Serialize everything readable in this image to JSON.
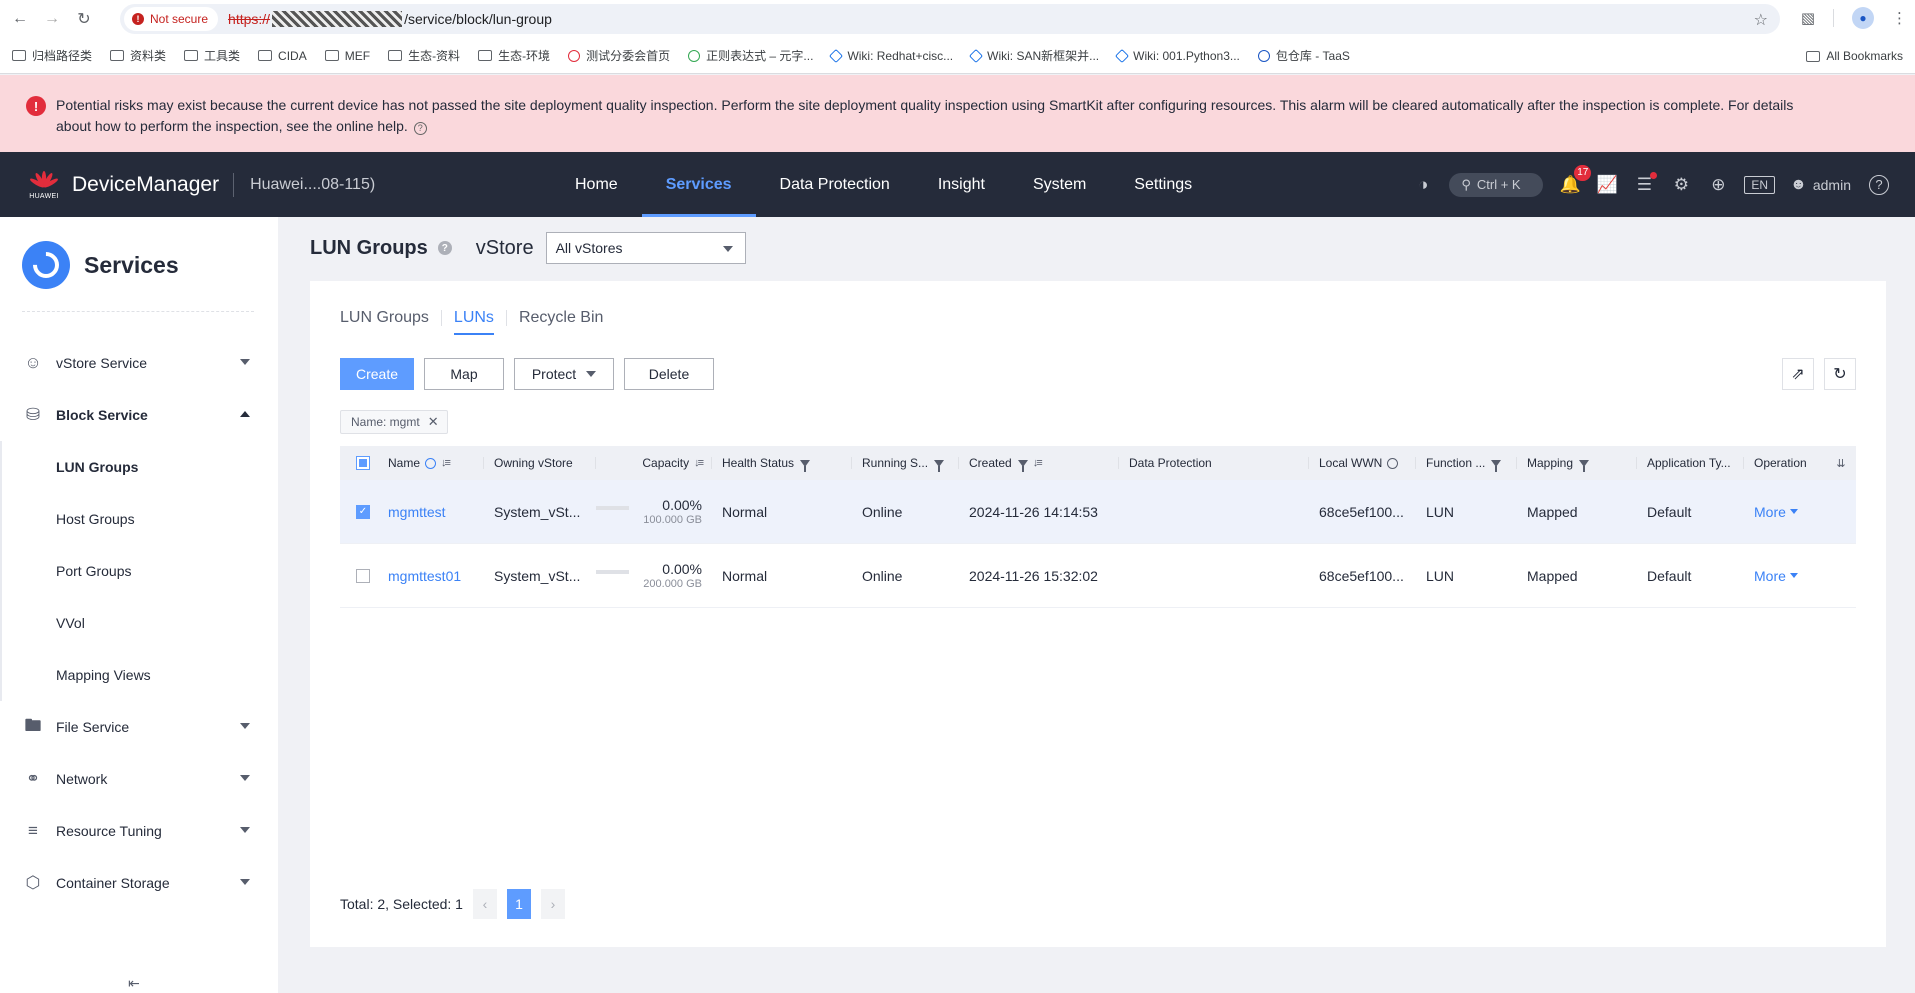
{
  "browser": {
    "security_label": "Not secure",
    "url_scheme": "https://",
    "url_path": "/service/block/lun-group",
    "bookmarks": [
      {
        "label": "归档路径类",
        "icon": "folder-icon"
      },
      {
        "label": "资料类",
        "icon": "folder-icon"
      },
      {
        "label": "工具类",
        "icon": "folder-icon"
      },
      {
        "label": "CIDA",
        "icon": "folder-icon"
      },
      {
        "label": "MEF",
        "icon": "folder-icon"
      },
      {
        "label": "生态-资料",
        "icon": "folder-icon"
      },
      {
        "label": "生态-环境",
        "icon": "folder-icon"
      },
      {
        "label": "测试分委会首页",
        "icon": "site-icon"
      },
      {
        "label": "正则表达式 – 元字...",
        "icon": "site-icon"
      },
      {
        "label": "Wiki: Redhat+cisc...",
        "icon": "wiki-icon"
      },
      {
        "label": "Wiki: SAN新框架并...",
        "icon": "wiki-icon"
      },
      {
        "label": "Wiki: 001.Python3...",
        "icon": "wiki-icon"
      },
      {
        "label": "包仓库 - TaaS",
        "icon": "site-icon"
      }
    ],
    "all_bookmarks": "All Bookmarks"
  },
  "alert": {
    "message": "Potential risks may exist because the current device has not passed the site deployment quality inspection. Perform the site deployment quality inspection using SmartKit after configuring resources. This alarm will be cleared automatically after the inspection is complete. For details about how to perform the inspection, see the online help.",
    "color": "#fad8dc"
  },
  "header": {
    "brand": "HUAWEI",
    "app_name": "DeviceManager",
    "device": "Huawei....08-115)",
    "nav": [
      {
        "label": "Home",
        "active": false
      },
      {
        "label": "Services",
        "active": true
      },
      {
        "label": "Data Protection",
        "active": false
      },
      {
        "label": "Insight",
        "active": false
      },
      {
        "label": "System",
        "active": false
      },
      {
        "label": "Settings",
        "active": false
      }
    ],
    "search_shortcut": "Ctrl + K",
    "notifications": "17",
    "language": "EN",
    "user": "admin"
  },
  "sidebar": {
    "title": "Services",
    "items": [
      {
        "label": "vStore Service",
        "icon": "users-icon",
        "expanded": false
      },
      {
        "label": "Block Service",
        "icon": "database-icon",
        "expanded": true,
        "children": [
          "LUN Groups",
          "Host Groups",
          "Port Groups",
          "VVol",
          "Mapping Views"
        ],
        "active_child": "LUN Groups"
      },
      {
        "label": "File Service",
        "icon": "folder-icon",
        "expanded": false
      },
      {
        "label": "Network",
        "icon": "planet-icon",
        "expanded": false
      },
      {
        "label": "Resource Tuning",
        "icon": "layers-icon",
        "expanded": false
      },
      {
        "label": "Container Storage",
        "icon": "hexagons-icon",
        "expanded": false
      }
    ]
  },
  "page": {
    "title": "LUN Groups",
    "vstore_label": "vStore",
    "vstore_value": "All vStores",
    "tabs": [
      {
        "label": "LUN Groups",
        "active": false
      },
      {
        "label": "LUNs",
        "active": true
      },
      {
        "label": "Recycle Bin",
        "active": false
      }
    ],
    "toolbar": {
      "create": "Create",
      "map": "Map",
      "protect": "Protect",
      "delete": "Delete"
    },
    "filter_tag": "Name: mgmt",
    "columns": [
      "Name",
      "Owning vStore",
      "Capacity",
      "Health Status",
      "Running S...",
      "Created",
      "Data Protection",
      "Local WWN",
      "Function ...",
      "Mapping",
      "Application Ty...",
      "Operation"
    ],
    "rows": [
      {
        "selected": true,
        "name": "mgmttest",
        "vstore": "System_vSt...",
        "capacity_pct": "0.00%",
        "capacity_used_fraction": 0.0,
        "capacity_size": "100.000 GB",
        "health": "Normal",
        "running": "Online",
        "created": "2024-11-26 14:14:53",
        "data_protection": "",
        "wwn": "68ce5ef100...",
        "function": "LUN",
        "mapping": "Mapped",
        "app_type": "Default",
        "operation": "More"
      },
      {
        "selected": false,
        "name": "mgmttest01",
        "vstore": "System_vSt...",
        "capacity_pct": "0.00%",
        "capacity_used_fraction": 0.0,
        "capacity_size": "200.000 GB",
        "health": "Normal",
        "running": "Online",
        "created": "2024-11-26 15:32:02",
        "data_protection": "",
        "wwn": "68ce5ef100...",
        "function": "LUN",
        "mapping": "Mapped",
        "app_type": "Default",
        "operation": "More"
      }
    ],
    "footer": {
      "summary": "Total: 2, Selected: 1",
      "current_page": "1"
    }
  },
  "colors": {
    "accent": "#5e9cff",
    "header_bg": "#252b3a",
    "danger": "#e22d3c"
  }
}
